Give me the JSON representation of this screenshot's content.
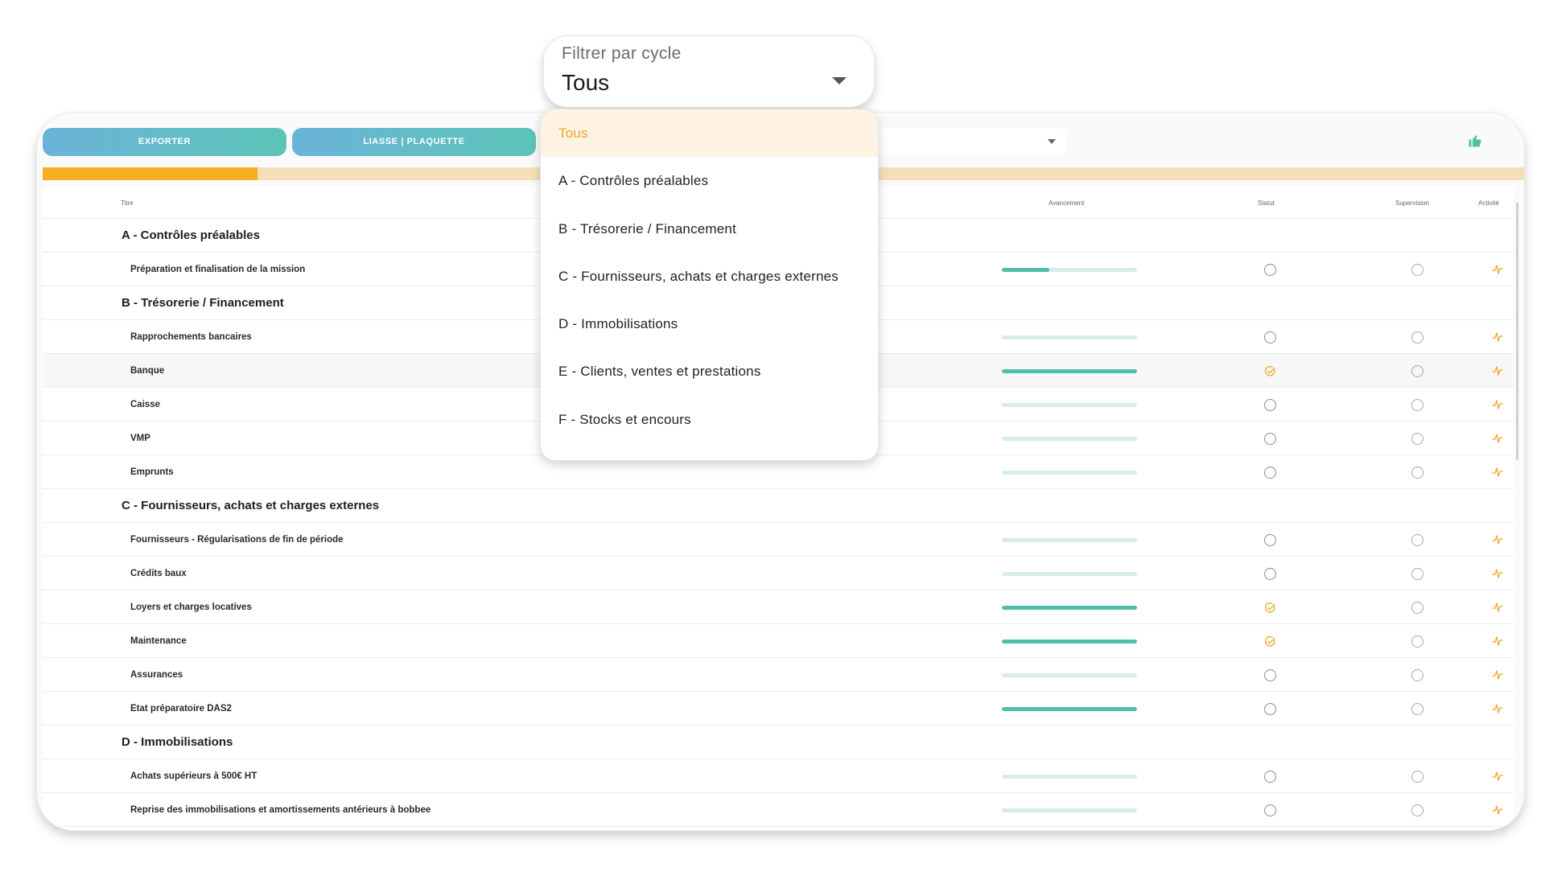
{
  "toolbar": {
    "export_label": "EXPORTER",
    "liasse_label": "LIASSE | PLAQUETTE",
    "like_icon": "thumbs-up-icon"
  },
  "progress": {
    "fraction": 0.145,
    "color_fill": "#f4b024",
    "color_track": "#f5dfb8"
  },
  "table": {
    "headers": {
      "title": "Titre",
      "progress": "Avancement",
      "status": "Statut",
      "supervision": "Supervision",
      "activity": "Activité"
    },
    "rows": [
      {
        "type": "cycle",
        "title": "A - Contrôles préalables"
      },
      {
        "type": "task",
        "title": "Préparation et finalisation de la mission",
        "progress": 0.35,
        "status": "empty"
      },
      {
        "type": "cycle",
        "title": "B - Trésorerie / Financement"
      },
      {
        "type": "task",
        "title": "Rapprochements bancaires",
        "progress": 0,
        "status": "empty"
      },
      {
        "type": "task",
        "title": "Banque",
        "progress": 1,
        "status": "done",
        "highlight": true
      },
      {
        "type": "task",
        "title": "Caisse",
        "progress": 0,
        "status": "empty"
      },
      {
        "type": "task",
        "title": "VMP",
        "progress": 0,
        "status": "empty"
      },
      {
        "type": "task",
        "title": "Emprunts",
        "progress": 0,
        "status": "empty"
      },
      {
        "type": "cycle",
        "title": "C - Fournisseurs, achats et charges externes"
      },
      {
        "type": "task",
        "title": "Fournisseurs - Régularisations de fin de période",
        "progress": 0,
        "status": "empty"
      },
      {
        "type": "task",
        "title": "Crédits baux",
        "progress": 0,
        "status": "empty"
      },
      {
        "type": "task",
        "title": "Loyers et charges locatives",
        "progress": 1,
        "status": "done"
      },
      {
        "type": "task",
        "title": "Maintenance",
        "progress": 1,
        "status": "done"
      },
      {
        "type": "task",
        "title": "Assurances",
        "progress": 0,
        "status": "empty"
      },
      {
        "type": "task",
        "title": "Etat préparatoire DAS2",
        "progress": 1,
        "status": "empty"
      },
      {
        "type": "cycle",
        "title": "D - Immobilisations"
      },
      {
        "type": "task",
        "title": "Achats supérieurs à 500€ HT",
        "progress": 0,
        "status": "empty"
      },
      {
        "type": "task",
        "title": "Reprise des immobilisations et amortissements antérieurs à bobbee",
        "progress": 0,
        "status": "empty"
      }
    ]
  },
  "filter": {
    "label": "Filtrer par cycle",
    "value": "Tous",
    "options": [
      "Tous",
      "A - Contrôles préalables",
      "B - Trésorerie / Financement",
      "C - Fournisseurs, achats et charges externes",
      "D - Immobilisations",
      "E - Clients, ventes et prestations",
      "F - Stocks et encours"
    ],
    "selected_index": 0
  },
  "colors": {
    "accent_orange": "#f0a52a",
    "teal": "#4fbfa8",
    "button_gradient_start": "#6bb3d9",
    "button_gradient_end": "#5cc4b6"
  }
}
